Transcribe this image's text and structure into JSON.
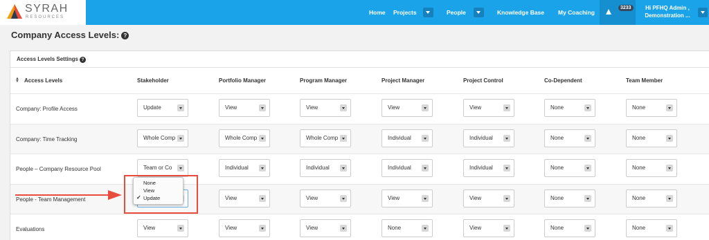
{
  "brand": {
    "name": "SYRAH",
    "sub": "RESOURCES"
  },
  "nav": {
    "home": "Home",
    "projects": "Projects",
    "people": "People",
    "knowledge": "Knowledge Base",
    "coaching": "My Coaching",
    "badge": "3233",
    "user_line1": "Hi PFHQ Admin ,",
    "user_line2": "Demonstration ..."
  },
  "page": {
    "title": "Company Access Levels:",
    "help": "?"
  },
  "panel": {
    "title": "Access Levels Settings",
    "help": "?"
  },
  "columns": {
    "access": "Access Levels",
    "c0": "Stakeholder",
    "c1": "Portfolio Manager",
    "c2": "Program Manager",
    "c3": "Project Manager",
    "c4": "Project Control",
    "c5": "Co-Dependent",
    "c6": "Team Member"
  },
  "rows": {
    "r0": {
      "label": "Company: Profile Access",
      "v": [
        "Update",
        "View",
        "View",
        "View",
        "View",
        "None",
        "None"
      ]
    },
    "r1": {
      "label": "Company: Time Tracking",
      "v": [
        "Whole Comp",
        "Whole Comp",
        "Whole Comp",
        "Individual",
        "Individual",
        "None",
        "None"
      ]
    },
    "r2": {
      "label": "People – Company Resource Pool",
      "v": [
        "Team or Co",
        "Individual",
        "Individual",
        "Individual",
        "Individual",
        "None",
        "None"
      ]
    },
    "r3": {
      "label": "People - Team Management",
      "v": [
        "",
        "View",
        "View",
        "View",
        "View",
        "None",
        "None"
      ]
    },
    "r4": {
      "label": "Evaluations",
      "v": [
        "View",
        "View",
        "View",
        "None",
        "View",
        "None",
        "None"
      ]
    }
  },
  "popup": {
    "options": [
      "None",
      "View",
      "Update"
    ],
    "selected": "Update",
    "check": "✓"
  },
  "colors": {
    "nav": "#1aa3e8",
    "highlight": "#e74c3c"
  }
}
